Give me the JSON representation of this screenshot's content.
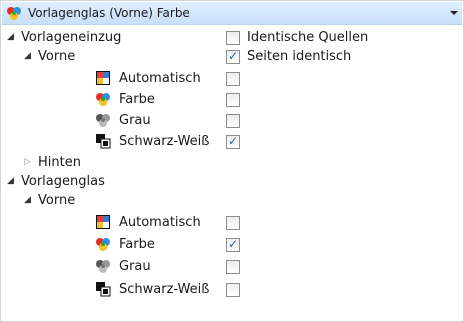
{
  "combo": {
    "title": "Vorlagenglas (Vorne) Farbe",
    "icon": "color-icon"
  },
  "tree": {
    "vorlageneinzug": "Vorlageneinzug",
    "vorne1": "Vorne",
    "hinten": "Hinten",
    "vorlagenglas": "Vorlagenglas",
    "vorne2": "Vorne"
  },
  "options": {
    "identische_quellen": {
      "label": "Identische Quellen",
      "checked": false
    },
    "seiten_identisch": {
      "label": "Seiten identisch",
      "checked": true
    }
  },
  "feeder_front": [
    {
      "label": "Automatisch",
      "icon": "auto-icon",
      "checked": false
    },
    {
      "label": "Farbe",
      "icon": "color-icon",
      "checked": false
    },
    {
      "label": "Grau",
      "icon": "gray-icon",
      "checked": false
    },
    {
      "label": "Schwarz-Weiß",
      "icon": "bw-icon",
      "checked": true
    }
  ],
  "glass_front": [
    {
      "label": "Automatisch",
      "icon": "auto-icon",
      "checked": false
    },
    {
      "label": "Farbe",
      "icon": "color-icon",
      "checked": true
    },
    {
      "label": "Grau",
      "icon": "gray-icon",
      "checked": false
    },
    {
      "label": "Schwarz-Weiß",
      "icon": "bw-icon",
      "checked": false
    }
  ]
}
